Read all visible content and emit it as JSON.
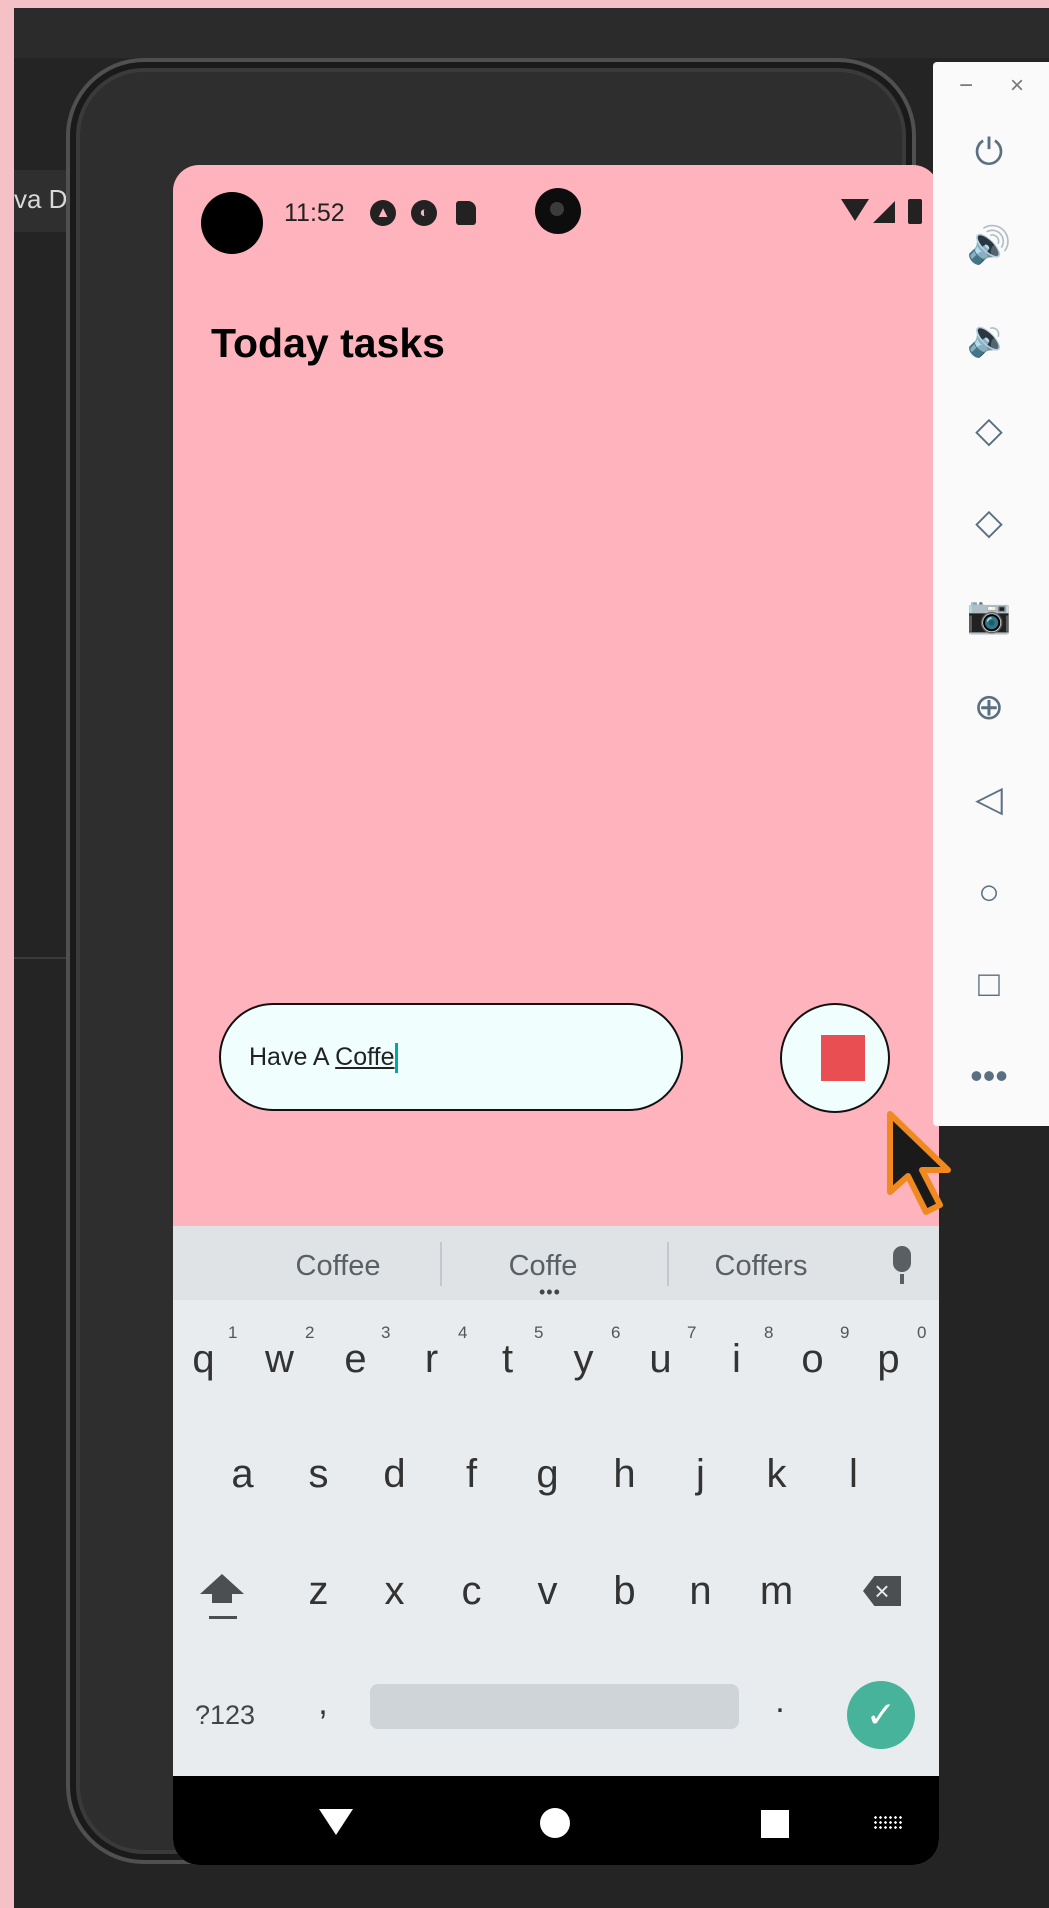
{
  "background": {
    "editor_tab": "va D"
  },
  "status_bar": {
    "time": "11:52",
    "icons": [
      "avatar-circle",
      "notification-icon-a",
      "notification-icon-b",
      "sd-card-icon",
      "camera-cutout",
      "wifi-icon",
      "signal-icon",
      "battery-icon"
    ]
  },
  "app": {
    "title": "Today tasks",
    "input": {
      "text_committed": "Have A ",
      "text_composing": "Coffe",
      "cursor": true
    },
    "record_button_icon": "stop-icon",
    "colors": {
      "background": "#ffb3bc",
      "input_bg": "#f0fffe",
      "stop": "#e94f52"
    }
  },
  "keyboard": {
    "suggestions": [
      "Coffee",
      "Coffe",
      "Coffers"
    ],
    "suggestions_more": "•••",
    "row1": [
      "q",
      "w",
      "e",
      "r",
      "t",
      "y",
      "u",
      "i",
      "o",
      "p"
    ],
    "row1_hints": [
      "1",
      "2",
      "3",
      "4",
      "5",
      "6",
      "7",
      "8",
      "9",
      "0"
    ],
    "row2": [
      "a",
      "s",
      "d",
      "f",
      "g",
      "h",
      "j",
      "k",
      "l"
    ],
    "row3": [
      "z",
      "x",
      "c",
      "v",
      "b",
      "n",
      "m"
    ],
    "symbols_key": "?123",
    "comma_key": ",",
    "period_key": ".",
    "enter_key": "✓",
    "enter_color": "#47b39a"
  },
  "nav_bar": {
    "icons": [
      "back-icon",
      "home-icon",
      "recents-icon",
      "keyboard-switch-icon"
    ]
  },
  "emulator_panel": {
    "minimize": "−",
    "close": "×",
    "controls": [
      "power-icon",
      "volume-up-icon",
      "volume-down-icon",
      "rotate-left-icon",
      "rotate-right-icon",
      "screenshot-icon",
      "zoom-icon",
      "back-icon",
      "home-icon",
      "overview-icon",
      "more-icon"
    ]
  }
}
